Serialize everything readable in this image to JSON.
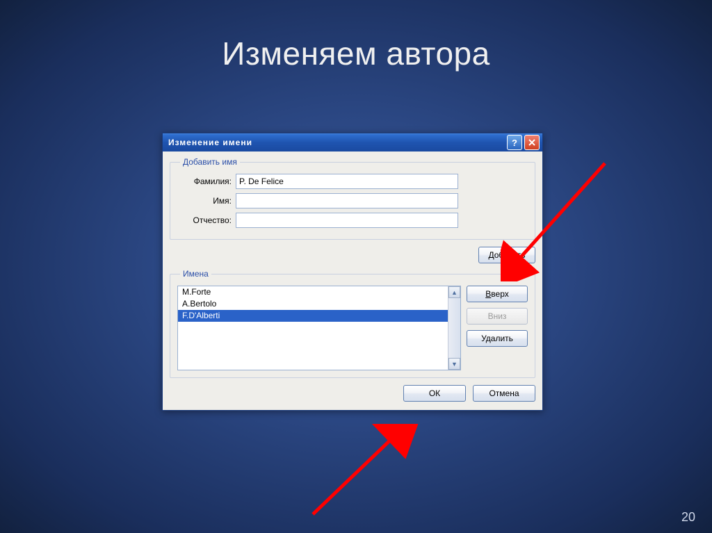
{
  "slide": {
    "title": "Изменяем автора",
    "page_number": "20"
  },
  "dialog": {
    "title": "Изменение имени",
    "group_add": {
      "legend": "Добавить имя",
      "surname_label": "Фамилия:",
      "surname_value": "P. De Felice",
      "firstname_label": "Имя:",
      "firstname_value": "",
      "patronymic_label": "Отчество:",
      "patronymic_value": ""
    },
    "add_button": "Добавить",
    "group_names": {
      "legend": "Имена",
      "items": [
        "M.Forte",
        "A.Bertolo",
        "F.D'Alberti"
      ],
      "selected_index": 2
    },
    "buttons": {
      "up": "Вверх",
      "down": "Вниз",
      "delete": "Удалить",
      "ok": "ОК",
      "cancel": "Отмена"
    }
  }
}
